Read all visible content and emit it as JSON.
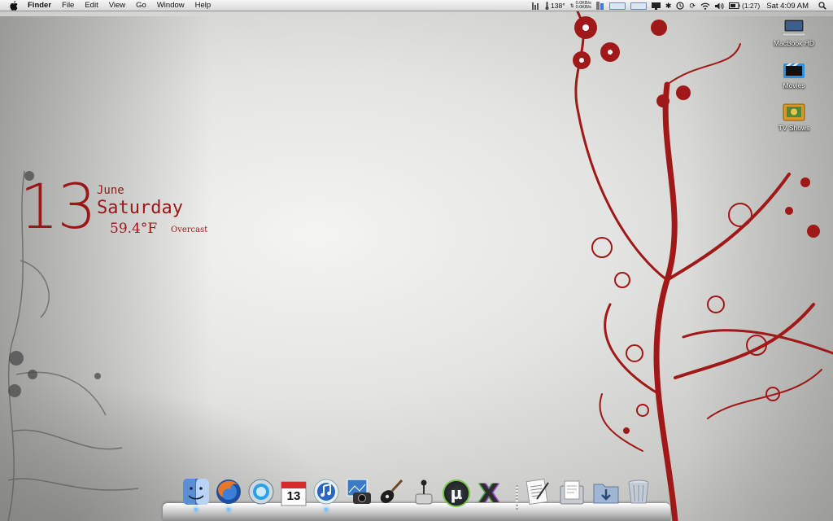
{
  "menubar": {
    "apple_icon": "apple-icon",
    "app_name": "Finder",
    "menus": [
      "File",
      "Edit",
      "View",
      "Go",
      "Window",
      "Help"
    ],
    "status": {
      "temperature": "138°",
      "net_up": "0.0KB/s",
      "net_down": "0.0KB/s",
      "battery": "(1:27)",
      "clock": "Sat 4:09 AM"
    }
  },
  "widget": {
    "day_number": "13",
    "month": "June",
    "weekday": "Saturday",
    "temperature": "59.4°F",
    "condition": "Overcast"
  },
  "desktop_icons": [
    {
      "label": "MacBook HD",
      "icon": "hard-drive-icon"
    },
    {
      "label": "Movies",
      "icon": "movies-folder-icon"
    },
    {
      "label": "TV Shows",
      "icon": "tv-shows-folder-icon"
    }
  ],
  "dock": {
    "items": [
      {
        "name": "finder",
        "icon": "finder-icon"
      },
      {
        "name": "firefox",
        "icon": "firefox-icon"
      },
      {
        "name": "quicktime",
        "icon": "quicktime-icon"
      },
      {
        "name": "ical",
        "icon": "calendar-icon",
        "badge": "13"
      },
      {
        "name": "itunes",
        "icon": "itunes-icon"
      },
      {
        "name": "iphoto",
        "icon": "iphoto-icon"
      },
      {
        "name": "garageband",
        "icon": "garageband-icon"
      },
      {
        "name": "joystick",
        "icon": "joystick-icon"
      },
      {
        "name": "utorrent",
        "icon": "utorrent-icon",
        "glyph": "µ"
      },
      {
        "name": "crossover",
        "icon": "x-app-icon",
        "glyph": "X"
      },
      {
        "name": "textedit",
        "icon": "textedit-icon"
      },
      {
        "name": "documents",
        "icon": "documents-stack-icon"
      },
      {
        "name": "downloads",
        "icon": "downloads-folder-icon"
      },
      {
        "name": "trash",
        "icon": "trash-icon"
      }
    ]
  },
  "colors": {
    "accent_red": "#9b1616",
    "menubar_bg": "#ececec"
  }
}
